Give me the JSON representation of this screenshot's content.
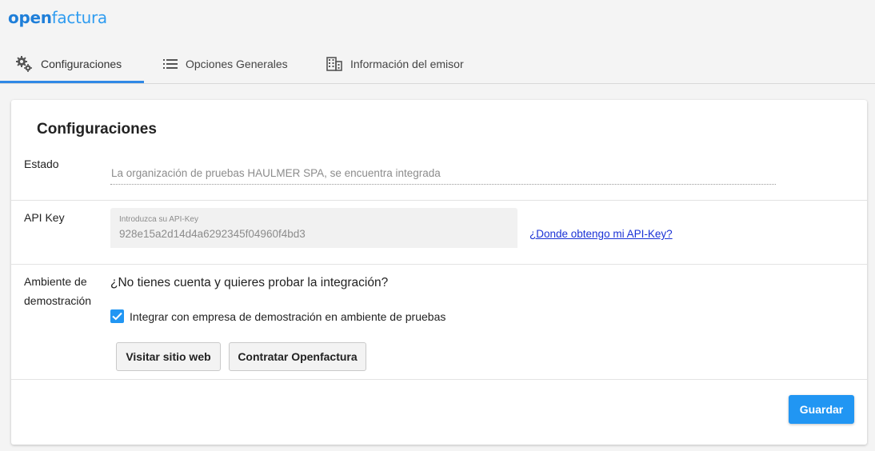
{
  "brand": {
    "part1": "open",
    "part2": "factura"
  },
  "tabs": [
    {
      "label": "Configuraciones",
      "icon": "gears-icon"
    },
    {
      "label": "Opciones Generales",
      "icon": "list-icon"
    },
    {
      "label": "Información del emisor",
      "icon": "building-icon"
    }
  ],
  "card": {
    "title": "Configuraciones",
    "estado": {
      "label": "Estado",
      "value": "La organización de pruebas HAULMER SPA, se encuentra integrada"
    },
    "api_key": {
      "label": "API Key",
      "placeholder": "Introduzca su API-Key",
      "value": "928e15a2d14d4a6292345f04960f4bd3",
      "help_link": "¿Donde obtengo mi API-Key?"
    },
    "demo": {
      "label_line1": "Ambiente de",
      "label_line2": "demostración",
      "question": "¿No tienes cuenta y quieres probar la integración?",
      "checkbox_label": "Integrar con empresa de demostración en ambiente de pruebas",
      "checkbox_checked": true,
      "visit_button": "Visitar sitio web",
      "contract_button": "Contratar Openfactura"
    },
    "save_button": "Guardar"
  },
  "colors": {
    "accent": "#2196f3",
    "link": "#1a32d6",
    "brand": "#1f7fd9"
  }
}
